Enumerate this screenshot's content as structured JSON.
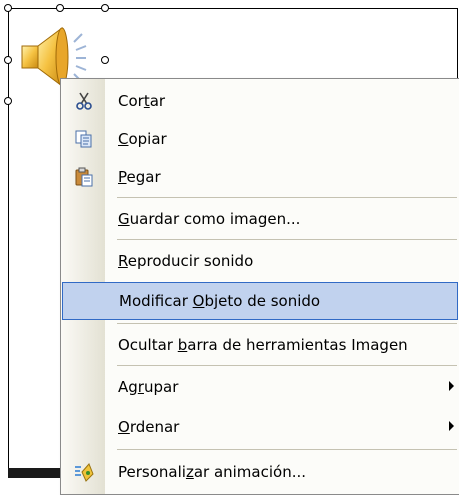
{
  "menu": {
    "items": [
      {
        "pre": "Cor",
        "accel": "t",
        "post": "ar",
        "icon": "scissors-icon"
      },
      {
        "pre": "",
        "accel": "C",
        "post": "opiar",
        "icon": "copy-icon"
      },
      {
        "pre": "",
        "accel": "P",
        "post": "egar",
        "icon": "paste-icon"
      },
      {
        "pre": "",
        "accel": "G",
        "post": "uardar como imagen...",
        "icon": ""
      },
      {
        "pre": "",
        "accel": "R",
        "post": "eproducir sonido",
        "icon": ""
      },
      {
        "pre": "Modificar ",
        "accel": "O",
        "post": "bjeto de sonido",
        "icon": "",
        "highlighted": true
      },
      {
        "pre": "Ocultar ",
        "accel": "b",
        "post": "arra de herramientas Imagen",
        "icon": ""
      },
      {
        "pre": "Ag",
        "accel": "r",
        "post": "upar",
        "icon": "",
        "submenu": true
      },
      {
        "pre": "",
        "accel": "O",
        "post": "rdenar",
        "icon": "",
        "submenu": true
      },
      {
        "pre": "Personali",
        "accel": "z",
        "post": "ar animación...",
        "icon": "custom-animation-icon"
      }
    ]
  },
  "colors": {
    "highlight_bg": "#c1d2ee",
    "highlight_border": "#316ac5",
    "gutter": "#e3e1d3"
  }
}
